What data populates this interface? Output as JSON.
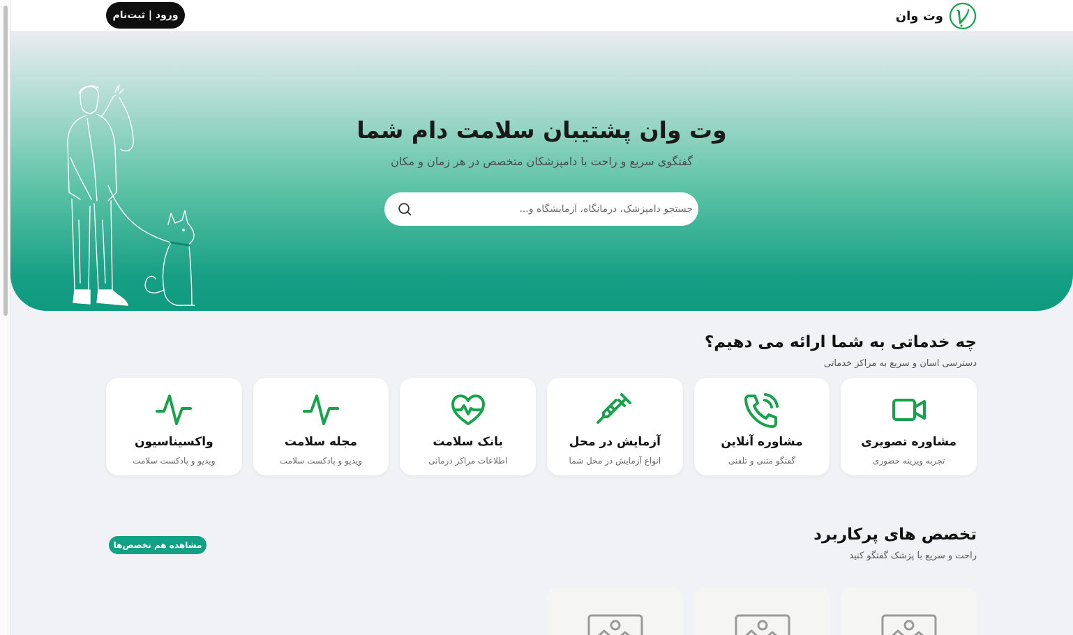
{
  "header": {
    "brand_name": "وت وان",
    "login_label": "ورود | ثبت‌نام"
  },
  "hero": {
    "title": "وت وان پشتیبان سلامت دام شما",
    "subtitle": "گفتگوی سریع و راحت با دامپزشکان متخصص در هر زمان و مکان",
    "search_placeholder": "جستجو دامپزشک، درمانگاه، آزمایشگاه و..."
  },
  "services": {
    "title": "چه خدماتی به شما ارائه می دهیم؟",
    "subtitle": "دسترسی اسان و سریع به مراکز خدماتی",
    "items": [
      {
        "title": "مشاوره تصویری",
        "desc": "تجربه ویزینه حضوری",
        "icon": "video-camera-icon"
      },
      {
        "title": "مشاوره آنلاین",
        "desc": "گفتگو متنی و تلفنی",
        "icon": "phone-call-icon"
      },
      {
        "title": "آزمایش در محل",
        "desc": "انواع آزمایش در محل شما",
        "icon": "syringe-icon"
      },
      {
        "title": "بانک سلامت",
        "desc": "اطلاعات مراکز درمانی",
        "icon": "heart-pulse-icon"
      },
      {
        "title": "مجله سلامت",
        "desc": "ویدیو و پادکست سلامت",
        "icon": "activity-icon"
      },
      {
        "title": "واکسیناسیون",
        "desc": "ویدیو و پادکست سلامت",
        "icon": "activity-icon"
      }
    ]
  },
  "specialties": {
    "title": "تخصص های پرکاربرد",
    "subtitle": "راحت و سریع با پزشک گفتگو کنید",
    "see_all_label": "مشاهده هم تخصص‌ها"
  },
  "colors": {
    "accent": "#13a185",
    "icon_green": "#17a34a",
    "dark_button": "#0f0f0f"
  }
}
